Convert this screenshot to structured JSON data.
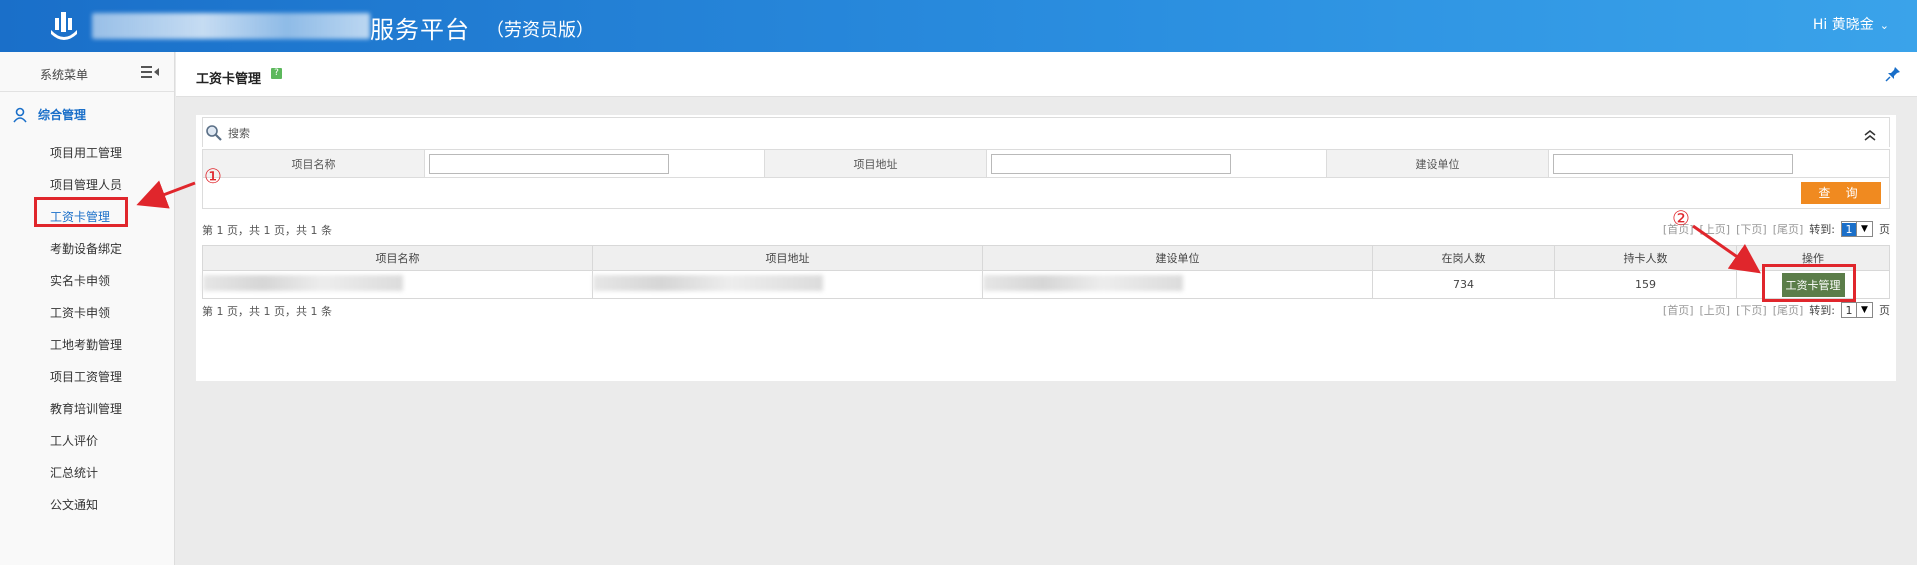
{
  "header": {
    "title": "服务平台",
    "edition": "（劳资员版）",
    "user_greeting": "Hi 黄晓金"
  },
  "sidebar": {
    "title": "系统菜单",
    "group": "综合管理",
    "items": [
      {
        "label": "项目用工管理"
      },
      {
        "label": "项目管理人员"
      },
      {
        "label": "工资卡管理"
      },
      {
        "label": "考勤设备绑定"
      },
      {
        "label": "实名卡申领"
      },
      {
        "label": "工资卡申领"
      },
      {
        "label": "工地考勤管理"
      },
      {
        "label": "项目工资管理"
      },
      {
        "label": "教育培训管理"
      },
      {
        "label": "工人评价"
      },
      {
        "label": "汇总统计"
      },
      {
        "label": "公文通知"
      }
    ],
    "active_index": 2
  },
  "page": {
    "title": "工资卡管理",
    "help": "?"
  },
  "search": {
    "label": "搜索",
    "fields": [
      {
        "label": "项目名称",
        "value": ""
      },
      {
        "label": "项目地址",
        "value": ""
      },
      {
        "label": "建设单位",
        "value": ""
      }
    ],
    "query_button": "查 询"
  },
  "pager": {
    "info": "第 1 页，共 1 页，共 1 条",
    "first": "[首页]",
    "prev": "[上页]",
    "next": "[下页]",
    "last": "[尾页]",
    "goto": "转到:",
    "page": "1",
    "page_suffix": "页"
  },
  "table": {
    "columns": [
      "项目名称",
      "项目地址",
      "建设单位",
      "在岗人数",
      "持卡人数",
      "操作"
    ],
    "rows": [
      {
        "on_duty": "734",
        "card_holders": "159",
        "action": "工资卡管理"
      }
    ]
  },
  "annotations": {
    "step1": "①",
    "step2": "②"
  },
  "colors": {
    "header_blue": "#1a6fc9",
    "query_orange": "#f08a20",
    "action_green": "#5b7d49",
    "highlight_red": "#e0262c"
  }
}
